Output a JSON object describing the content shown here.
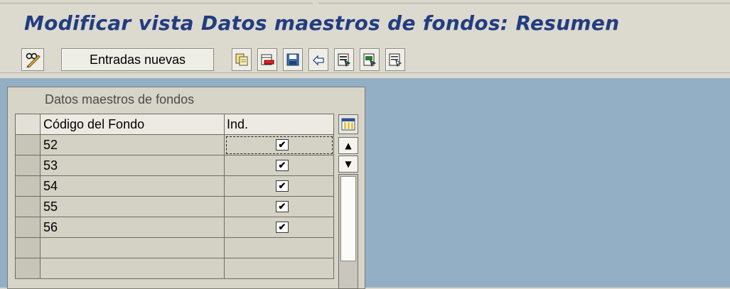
{
  "title": "Modificar vista Datos maestros de fondos: Resumen",
  "toolbar": {
    "buttons": [
      {
        "icon": "pencil-glasses-icon",
        "label": ""
      },
      {
        "icon": "",
        "label": "Entradas nuevas"
      },
      {
        "icon": "copy-icon",
        "label": ""
      },
      {
        "icon": "delete-icon",
        "label": ""
      },
      {
        "icon": "save-icon",
        "label": ""
      },
      {
        "icon": "undo-icon",
        "label": ""
      },
      {
        "icon": "select-all-icon",
        "label": ""
      },
      {
        "icon": "select-block-icon",
        "label": ""
      },
      {
        "icon": "deselect-all-icon",
        "label": ""
      }
    ]
  },
  "panel": {
    "title": "Datos maestros de fondos",
    "columns": [
      "Código del Fondo",
      "Ind."
    ],
    "rows": [
      {
        "code": "52",
        "ind": true
      },
      {
        "code": "53",
        "ind": true
      },
      {
        "code": "54",
        "ind": true
      },
      {
        "code": "55",
        "ind": true
      },
      {
        "code": "56",
        "ind": true
      },
      {
        "code": "",
        "ind": null
      },
      {
        "code": "",
        "ind": null
      }
    ]
  },
  "colors": {
    "title": "#223d80",
    "background": "#93afc6",
    "panel": "#d7d4c8"
  }
}
